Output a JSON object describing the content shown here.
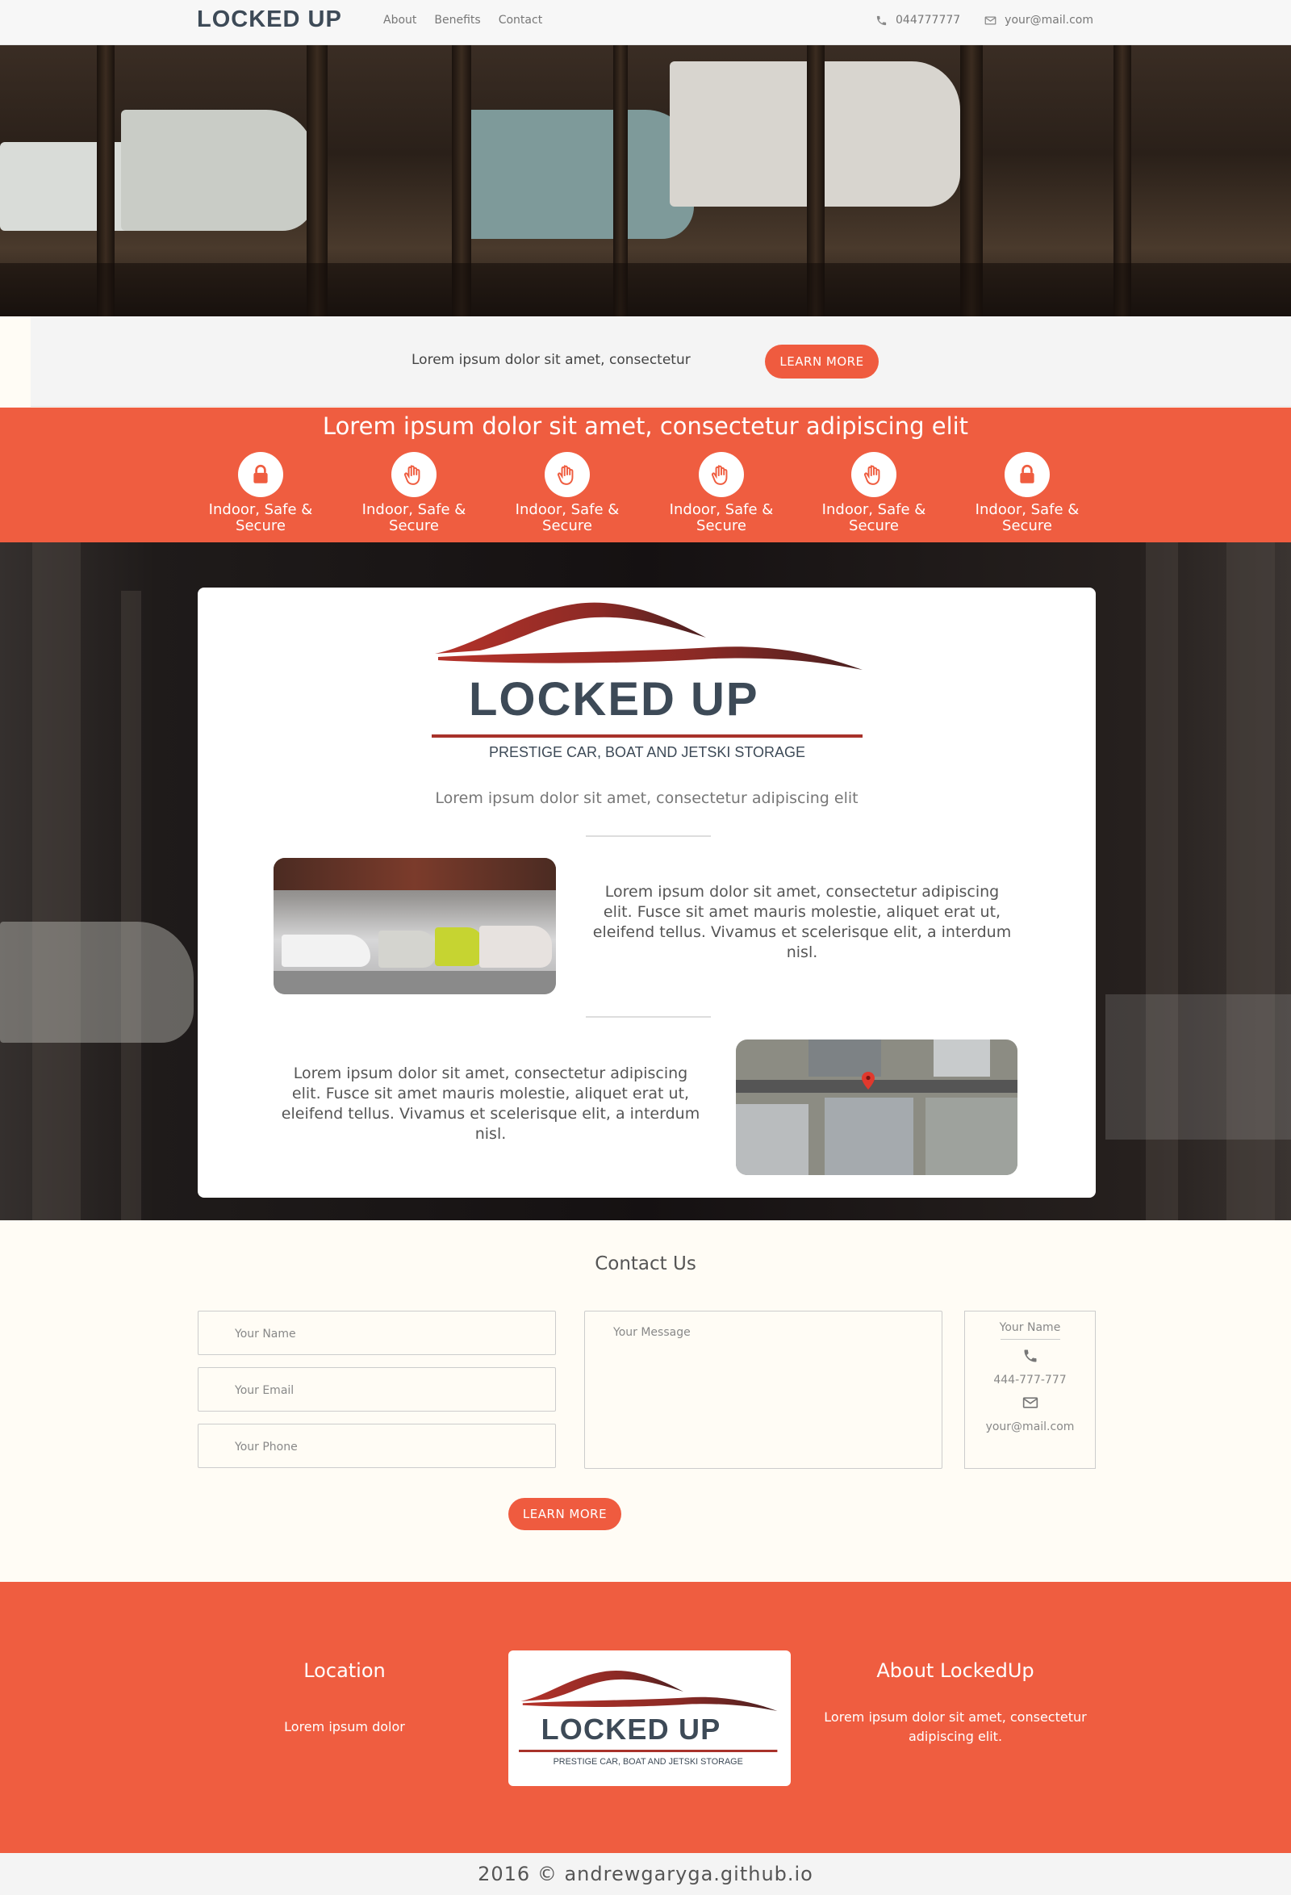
{
  "nav": {
    "logo": "LOCKED UP",
    "links": [
      "About",
      "Benefits",
      "Contact"
    ],
    "phone": "044777777",
    "email": "your@mail.com"
  },
  "cta": {
    "text": "Lorem ipsum dolor sit amet, consectetur",
    "button": "LEARN MORE"
  },
  "features": {
    "title": "Lorem ipsum dolor sit amet, consectetur adipiscing elit",
    "items": [
      {
        "line1": "Indoor, Safe &",
        "line2": "Secure",
        "icon": "lock-icon"
      },
      {
        "line1": "Indoor, Safe &",
        "line2": "Secure",
        "icon": "hand-icon"
      },
      {
        "line1": "Indoor, Safe &",
        "line2": "Secure",
        "icon": "hand-icon"
      },
      {
        "line1": "Indoor, Safe &",
        "line2": "Secure",
        "icon": "hand-icon"
      },
      {
        "line1": "Indoor, Safe &",
        "line2": "Secure",
        "icon": "hand-icon"
      },
      {
        "line1": "Indoor, Safe &",
        "line2": "Secure",
        "icon": "lock-icon"
      }
    ]
  },
  "showcase": {
    "logo_title": "LOCKED UP",
    "logo_tagline": "PRESTIGE CAR, BOAT AND JETSKI STORAGE",
    "subtitle": "Lorem ipsum dolor sit amet, consectetur adipiscing elit",
    "para1": "Lorem ipsum dolor sit amet, consectetur adipiscing elit. Fusce sit amet mauris molestie, aliquet erat ut, eleifend tellus. Vivamus et scelerisque elit, a interdum nisl.",
    "para2": "Lorem ipsum dolor sit amet, consectetur adipiscing elit. Fusce sit amet mauris molestie, aliquet erat ut, eleifend tellus. Vivamus et scelerisque elit, a interdum nisl."
  },
  "contact": {
    "title": "Contact Us",
    "name_placeholder": "Your Name",
    "email_placeholder": "Your Email",
    "phone_placeholder": "Your Phone",
    "message_placeholder": "Your Message",
    "card_name": "Your Name",
    "card_phone": "444-777-777",
    "card_email": "your@mail.com",
    "button": "LEARN MORE"
  },
  "footer": {
    "location_title": "Location",
    "location_text": "Lorem ipsum dolor",
    "about_title": "About LockedUp",
    "about_text": "Lorem ipsum dolor sit amet, consectetur adipiscing elit.",
    "logo_title": "LOCKED UP",
    "logo_tagline": "PRESTIGE CAR, BOAT AND JETSKI STORAGE",
    "copyright": "2016 © andrewgaryga.github.io"
  },
  "colors": {
    "accent": "#ef5d40",
    "logo_dark": "#3d4a57",
    "logo_red": "#a8322a"
  }
}
